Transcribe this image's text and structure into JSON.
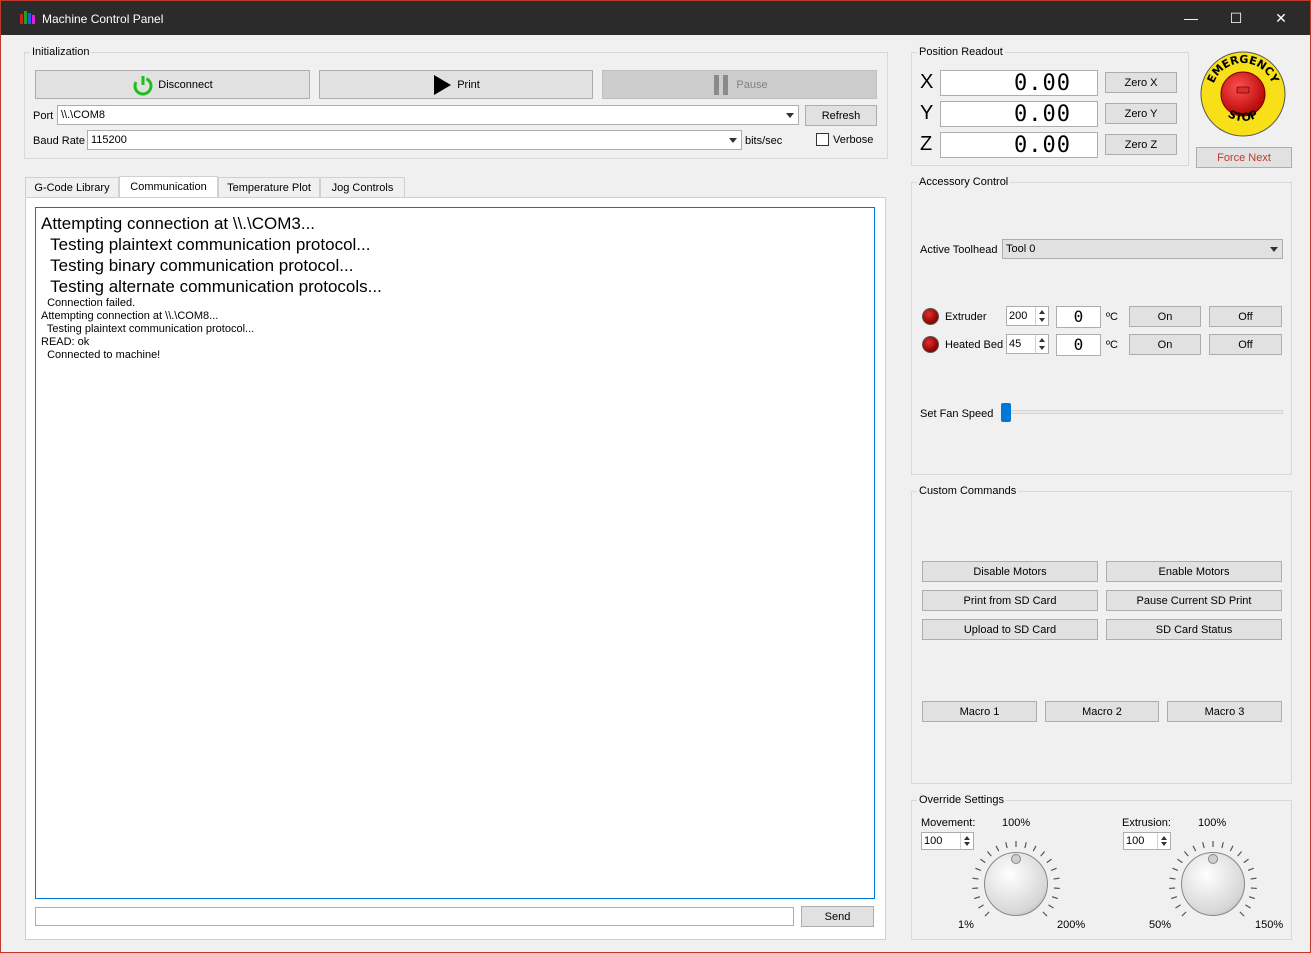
{
  "window": {
    "title": "Machine Control Panel",
    "minimize": "—",
    "maximize": "☐",
    "close": "✕"
  },
  "initialization": {
    "group_title": "Initialization",
    "disconnect_label": "Disconnect",
    "print_label": "Print",
    "pause_label": "Pause",
    "port_label": "Port",
    "port_value": "\\\\.\\COM8",
    "refresh_label": "Refresh",
    "baud_label": "Baud Rate",
    "baud_value": "115200",
    "baud_unit": "bits/sec",
    "verbose_label": "Verbose",
    "verbose_checked": false
  },
  "position": {
    "group_title": "Position Readout",
    "axes": [
      {
        "axis": "X",
        "value": "0.00",
        "zero_label": "Zero X"
      },
      {
        "axis": "Y",
        "value": "0.00",
        "zero_label": "Zero Y"
      },
      {
        "axis": "Z",
        "value": "0.00",
        "zero_label": "Zero Z"
      }
    ]
  },
  "emergency": {
    "text_top": "EMERGENCY",
    "text_bottom": "STOP",
    "force_next_label": "Force Next"
  },
  "tabs": [
    {
      "label": "G-Code Library",
      "active": false
    },
    {
      "label": "Communication",
      "active": true
    },
    {
      "label": "Temperature Plot",
      "active": false
    },
    {
      "label": "Jog Controls",
      "active": false
    }
  ],
  "log": {
    "large_lines": [
      "Attempting connection at \\\\.\\COM3...",
      "  Testing plaintext communication protocol...",
      "  Testing binary communication protocol...",
      "  Testing alternate communication protocols..."
    ],
    "small_lines": [
      "  Connection failed.",
      "Attempting connection at \\\\.\\COM8...",
      "  Testing plaintext communication protocol...",
      "READ: ok",
      "  Connected to machine!"
    ]
  },
  "send": {
    "input_value": "",
    "send_label": "Send"
  },
  "accessory": {
    "group_title": "Accessory Control",
    "toolhead_label": "Active Toolhead",
    "toolhead_value": "Tool 0",
    "extruder": {
      "label": "Extruder",
      "setpoint": "200",
      "current": "0",
      "unit": "ºC",
      "on_label": "On",
      "off_label": "Off"
    },
    "heated_bed": {
      "label": "Heated Bed",
      "setpoint": "45",
      "current": "0",
      "unit": "ºC",
      "on_label": "On",
      "off_label": "Off"
    },
    "fan_label": "Set Fan Speed",
    "fan_speed_fraction": 0.0
  },
  "custom_commands": {
    "group_title": "Custom Commands",
    "buttons": [
      "Disable Motors",
      "Enable Motors",
      "Print from SD Card",
      "Pause Current SD Print",
      "Upload to SD Card",
      "SD Card Status"
    ],
    "macros": [
      "Macro 1",
      "Macro 2",
      "Macro 3"
    ]
  },
  "override": {
    "group_title": "Override Settings",
    "movement": {
      "label": "Movement:",
      "value": "100",
      "top": "100%",
      "min": "1%",
      "max": "200%"
    },
    "extrusion": {
      "label": "Extrusion:",
      "value": "100",
      "top": "100%",
      "min": "50%",
      "max": "150%"
    }
  },
  "colors": {
    "accent_blue": "#0078d7",
    "power_green": "#1bbf1b",
    "estop_yellow": "#f7e017",
    "estop_red": "#d21f1f",
    "force_next_text": "#c0392b"
  }
}
